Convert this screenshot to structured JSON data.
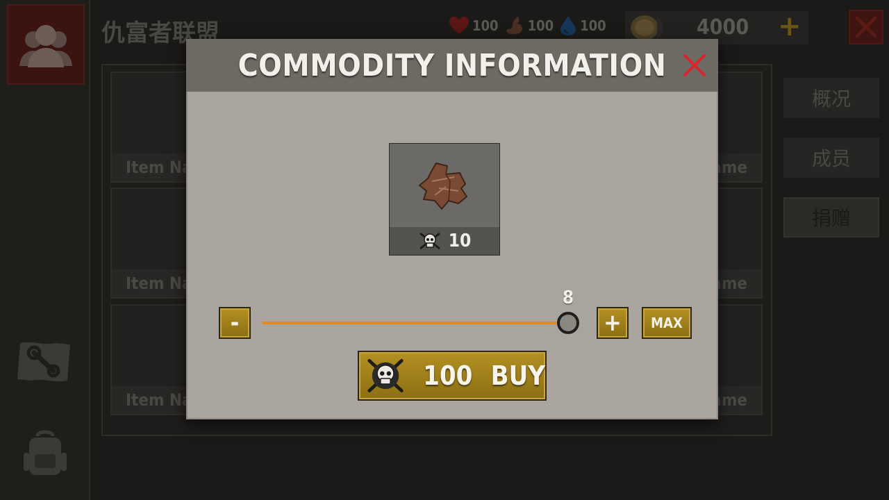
{
  "background": {
    "guild_title": "仇富者联盟",
    "stats": [
      {
        "icon": "heart-icon",
        "value": "100",
        "color": "#6b1b17"
      },
      {
        "icon": "stomach-icon",
        "value": "100",
        "color": "#5a3a28"
      },
      {
        "icon": "water-drop-icon",
        "value": "100",
        "color": "#1d3f66"
      }
    ],
    "coins": "4000",
    "grid_cells": [
      {
        "name": "Item Nam"
      },
      {
        "name": "ame"
      },
      {
        "name": "Item Nam"
      },
      {
        "name": "ame"
      },
      {
        "name": "Item Nam"
      },
      {
        "name": "ame"
      }
    ],
    "side_tabs": [
      {
        "label": "概况"
      },
      {
        "label": "成员"
      },
      {
        "label": "捐赠"
      }
    ]
  },
  "modal": {
    "title": "COMMODITY INFORMATION",
    "item": {
      "icon": "leather-scrap-icon",
      "price_icon": "skull-crossed-blades-icon",
      "price": "10"
    },
    "quantity": {
      "value": "8",
      "min": 0,
      "max": 8,
      "minus_label": "-",
      "plus_label": "+",
      "max_label": "MAX"
    },
    "buy": {
      "price": "100",
      "label": "BUY"
    },
    "colors": {
      "accent_gold": "#a6851c",
      "slider": "#e48a1a",
      "close_red": "#d8252b"
    }
  }
}
